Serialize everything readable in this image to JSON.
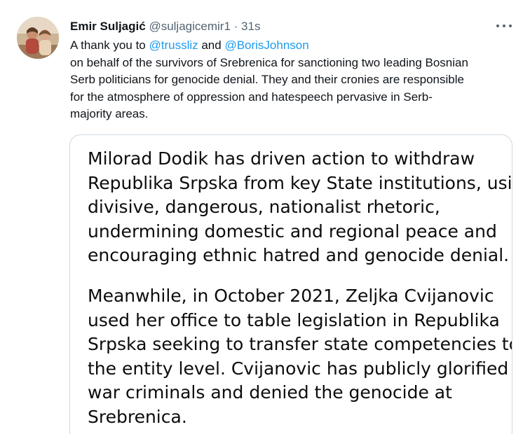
{
  "author": {
    "name": "Emir Suljagić",
    "handle": "@suljagicemir1",
    "separator": "·",
    "time": "31s",
    "avatar_icon": "profile-photo-icon"
  },
  "more_icon": "more-horizontal-icon",
  "tweet": {
    "line1_prefix": "A thank you to ",
    "mention1": "@trussliz",
    "line1_mid": " and ",
    "mention2": "@BorisJohnson",
    "line2": "on behalf of the survivors of Srebrenica for sanctioning two leading Bosnian",
    "line3": "Serb politicians for genocide denial. They and their cronies are responsible",
    "line4": "for the atmosphere of oppression and hatespeech pervasive in Serb-",
    "line5": "majority areas."
  },
  "media": {
    "paragraph1": [
      "Milorad Dodik has driven action to withdraw",
      "Republika Srpska from key State institutions, using",
      "divisive, dangerous, nationalist rhetoric,",
      "undermining domestic and regional peace and",
      "encouraging ethnic hatred and genocide denial."
    ],
    "paragraph2": [
      "Meanwhile, in October 2021, Zeljka Cvijanovic",
      "used her office to table legislation in Republika",
      "Srpska seeking to transfer state competencies to",
      "the entity level. Cvijanovic has publicly glorified",
      "war criminals and denied the genocide at",
      "Srebrenica."
    ]
  },
  "colors": {
    "link": "#1d9bf0",
    "secondary_text": "#536471",
    "primary_text": "#0f1419",
    "card_border": "#cfd9de"
  }
}
